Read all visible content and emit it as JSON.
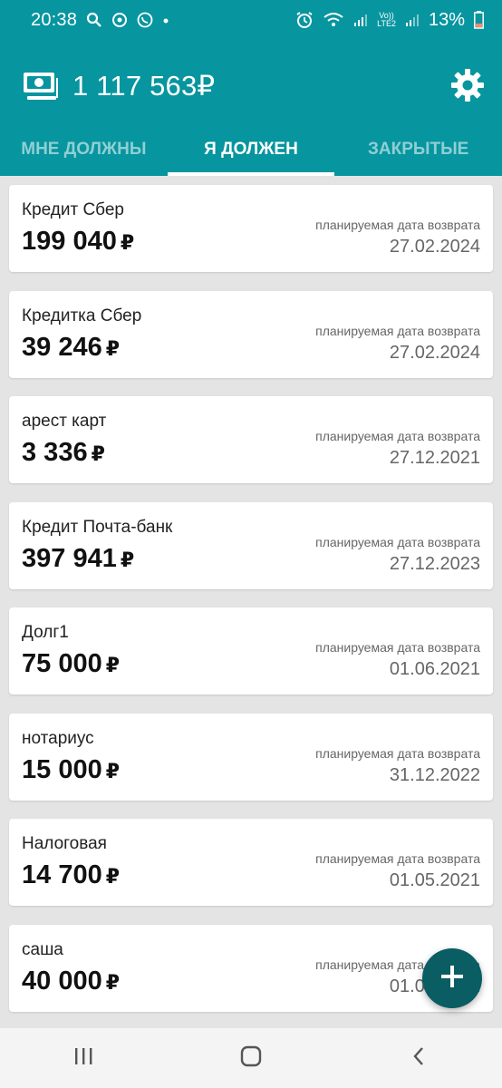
{
  "status_bar": {
    "time": "20:38",
    "battery_percent": "13%",
    "network": "LTE2",
    "icons": [
      "search-icon",
      "camera-sync-icon",
      "whatsapp-icon",
      "dot-icon",
      "alarm-icon",
      "wifi-icon",
      "signal-icon",
      "volte-icon",
      "signal-icon",
      "battery-icon"
    ]
  },
  "header": {
    "total_amount": "1 117 563₽",
    "icons": [
      "money-icon",
      "settings-icon"
    ],
    "color": "#07959f"
  },
  "tabs": [
    {
      "label": "МНЕ ДОЛЖНЫ",
      "active": false
    },
    {
      "label": "Я ДОЛЖЕН",
      "active": true
    },
    {
      "label": "ЗАКРЫТЫЕ",
      "active": false
    }
  ],
  "debts": [
    {
      "name": "Кредит Сбер",
      "amount": "199 040",
      "currency": "₽",
      "due_label": "планируемая дата возврата",
      "due_date": "27.02.2024"
    },
    {
      "name": "Кредитка Сбер",
      "amount": "39 246",
      "currency": "₽",
      "due_label": "планируемая дата возврата",
      "due_date": "27.02.2024"
    },
    {
      "name": "арест карт",
      "amount": "3 336",
      "currency": "₽",
      "due_label": "планируемая дата возврата",
      "due_date": "27.12.2021"
    },
    {
      "name": "Кредит Почта-банк",
      "amount": "397 941",
      "currency": "₽",
      "due_label": "планируемая дата возврата",
      "due_date": "27.12.2023"
    },
    {
      "name": "Долг1",
      "amount": "75 000",
      "currency": "₽",
      "due_label": "планируемая дата возврата",
      "due_date": "01.06.2021"
    },
    {
      "name": "нотариус",
      "amount": "15 000",
      "currency": "₽",
      "due_label": "планируемая дата возврата",
      "due_date": "31.12.2022"
    },
    {
      "name": "Налоговая",
      "amount": "14 700",
      "currency": "₽",
      "due_label": "планируемая дата возврата",
      "due_date": "01.05.2021"
    },
    {
      "name": "саша",
      "amount": "40 000",
      "currency": "₽",
      "due_label": "планируемая дата возврата",
      "due_date": "01.05.2021"
    }
  ],
  "fab": {
    "icon": "plus-icon",
    "color": "#0a5d63"
  },
  "nav_bar": {
    "icons": [
      "recent-apps-icon",
      "home-icon",
      "back-icon"
    ]
  }
}
